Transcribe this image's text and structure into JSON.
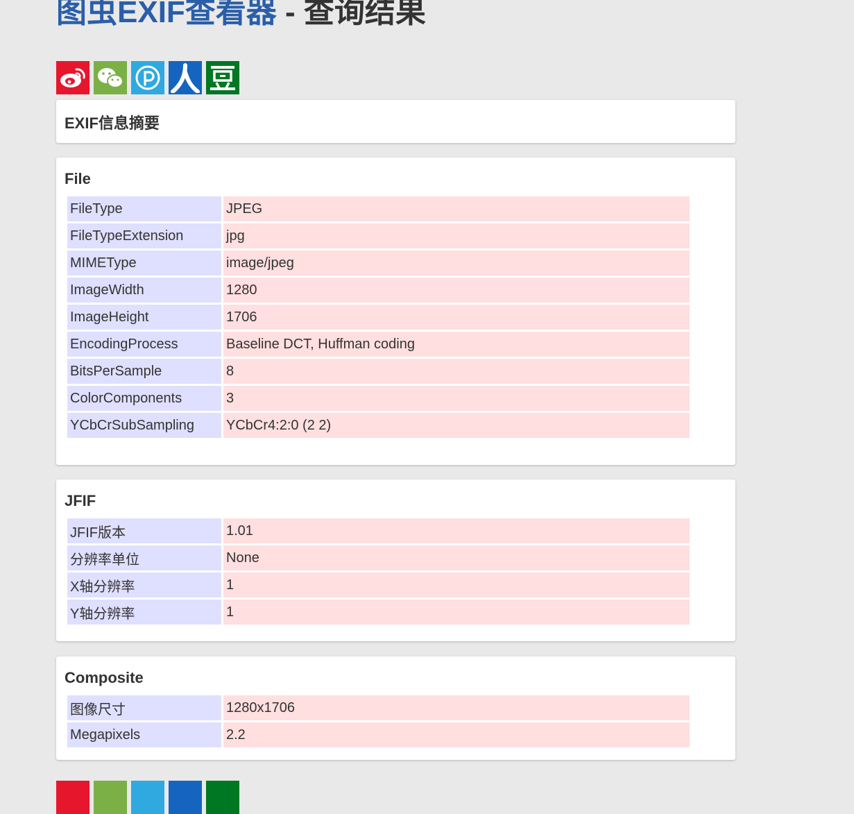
{
  "header": {
    "title_link": "图虫EXIF查看器",
    "title_rest": " - 查询结果"
  },
  "share": [
    {
      "name": "weibo",
      "color": "#e6162d"
    },
    {
      "name": "wechat",
      "color": "#7bb046"
    },
    {
      "name": "pengyou",
      "color": "#2fa9e0"
    },
    {
      "name": "renren",
      "color": "#1565c0"
    },
    {
      "name": "douban",
      "color": "#007722"
    }
  ],
  "summary": {
    "title": "EXIF信息摘要"
  },
  "sections": [
    {
      "title": "File",
      "rows": [
        [
          "FileType",
          "JPEG"
        ],
        [
          "FileTypeExtension",
          "jpg"
        ],
        [
          "MIMEType",
          "image/jpeg"
        ],
        [
          "ImageWidth",
          "1280"
        ],
        [
          "ImageHeight",
          "1706"
        ],
        [
          "EncodingProcess",
          "Baseline DCT, Huffman coding"
        ],
        [
          "BitsPerSample",
          "8"
        ],
        [
          "ColorComponents",
          "3"
        ],
        [
          "YCbCrSubSampling",
          "YCbCr4:2:0 (2 2)"
        ]
      ]
    },
    {
      "title": "JFIF",
      "rows": [
        [
          "JFIF版本",
          "1.01"
        ],
        [
          "分辨率单位",
          "None"
        ],
        [
          "X轴分辨率",
          "1"
        ],
        [
          "Y轴分辨率",
          "1"
        ]
      ]
    },
    {
      "title": "Composite",
      "rows": [
        [
          "图像尺寸",
          "1280x1706"
        ],
        [
          "Megapixels",
          "2.2"
        ]
      ]
    }
  ]
}
